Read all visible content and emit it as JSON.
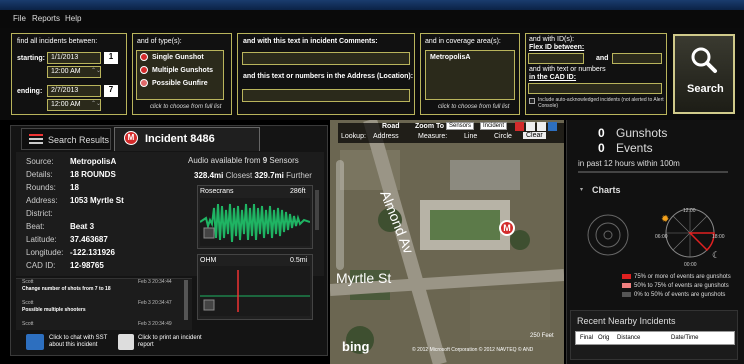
{
  "menu": {
    "file": "File",
    "reports": "Reports",
    "help": "Help"
  },
  "filters": {
    "find_all_label": "find all incidents between:",
    "starting_label": "starting:",
    "start_date": "1/1/2013",
    "start_day_badge": "1",
    "start_time": "12:00 AM",
    "ending_label": "ending:",
    "end_date": "2/7/2013",
    "end_day_badge": "7",
    "end_time": "12:00 AM",
    "type_label": "and of type(s):",
    "types": [
      "Single Gunshot",
      "Multiple Gunshots",
      "Possible Gunfire"
    ],
    "type_hint": "click to choose from full list",
    "comments_label": "and with this text in incident Comments:",
    "address_label": "and this text or numbers in the Address (Location):",
    "coverage_label": "and in coverage area(s):",
    "coverage_value": "MetropolisA",
    "coverage_hint": "click to choose from full list",
    "ids_label": "and with ID(s):",
    "flex_label": "Flex ID between:",
    "and_label": "and",
    "cad_label_line1": "and with text or numbers",
    "cad_label_line2": "in the CAD ID:",
    "auto_ack_label": "Include auto-acknowledged incidents (not alerted to Alert Console)",
    "search_button": "Search"
  },
  "tabs": {
    "search_results": "Search Results",
    "incident": "Incident 8486"
  },
  "incident": {
    "source_label": "Source:",
    "source": "MetropolisA",
    "details_label": "Details:",
    "details": "18 ROUNDS",
    "rounds_label": "Rounds:",
    "rounds": "18",
    "address_label": "Address:",
    "address": "1053 Myrtle  St",
    "district_label": "District:",
    "district": "",
    "beat_label": "Beat:",
    "beat": "Beat 3",
    "lat_label": "Latitude:",
    "lat": "37.463687",
    "lon_label": "Longitude:",
    "lon": "-122.131926",
    "cad_label": "CAD ID:",
    "cad": "12-98765"
  },
  "audio": {
    "header_prefix": "Audio available from ",
    "sensor_count": "9",
    "header_suffix": " Sensors",
    "closest_value": "328.4mi",
    "closest_label": "Closest",
    "further_value": "329.7mi",
    "further_label": "Further",
    "clips": [
      {
        "name": "Rosecrans",
        "distance": "286ft"
      },
      {
        "name": "OHM",
        "distance": "0.5mi"
      }
    ]
  },
  "comments": [
    {
      "author": "Scott",
      "time": "Feb 3 20:34:44",
      "text": "Change number of shots from 7 to 18"
    },
    {
      "author": "Scott",
      "time": "Feb 3 20:34:47",
      "text": "Possible multiple shooters"
    },
    {
      "author": "Scott",
      "time": "Feb 3 20:34:49",
      "text": ""
    }
  ],
  "actions": {
    "chat": "Click to chat with SST about this incident",
    "print": "Click to print an incident report"
  },
  "map": {
    "road": "Road",
    "zoom_to": "Zoom To",
    "sensors": "Sensors",
    "incident_btn": "Incident",
    "lookup": "Lookup:",
    "address_opt": "Address",
    "measure": "Measure:",
    "line": "Line",
    "circle": "Circle",
    "clear": "Clear",
    "street_1": "Almond Av",
    "street_2": "Myrtle St",
    "scale": "250 Feet",
    "copyright": "© 2012 Microsoft Corporation  © 2012 NAVTEQ  © AND",
    "bing": "bing"
  },
  "stats": {
    "gunshots_count": "0",
    "gunshots_label": "Gunshots",
    "events_count": "0",
    "events_label": "Events",
    "window_text": "in past 12 hours within 100m",
    "charts_label": "Charts",
    "clock": {
      "top": "12:00",
      "left": "06:00",
      "right": "18:00",
      "bottom": "00:00"
    },
    "legend": [
      {
        "label": "75% or more of events are gunshots",
        "color": "#e02020"
      },
      {
        "label": "50% to 75% of events are gunshots",
        "color": "#f08080"
      },
      {
        "label": "0% to 50% of events are gunshots",
        "color": "#555555"
      }
    ],
    "recent_label": "Recent Nearby Incidents",
    "table_headers": [
      "Final",
      "Orig",
      "Distance",
      "Date/Time"
    ]
  }
}
